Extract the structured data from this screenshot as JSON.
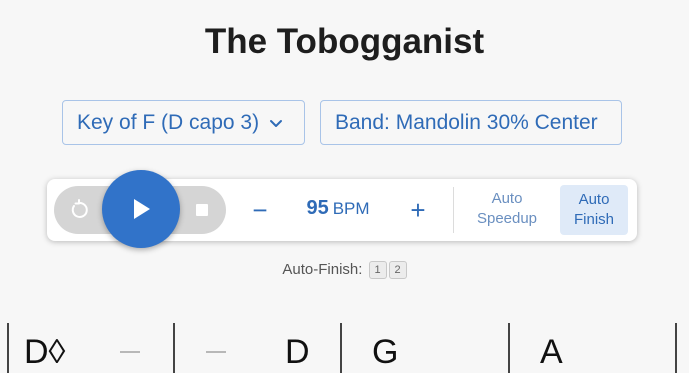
{
  "title": "The Tobogganist",
  "key_selector": {
    "label": "Key of F (D capo 3)",
    "icon": "chevron-down-icon"
  },
  "band_selector": {
    "label": "Band: Mandolin 30% Center"
  },
  "player": {
    "bpm_value": "95",
    "bpm_unit": "BPM",
    "minus_label": "−",
    "plus_label": "+",
    "auto_speedup": [
      "Auto",
      "Speedup"
    ],
    "auto_finish": [
      "Auto",
      "Finish"
    ],
    "auto_finish_active": true
  },
  "auto_finish_caption": {
    "label": "Auto-Finish:",
    "options": [
      "1",
      "2"
    ]
  },
  "chords": {
    "measure1": {
      "chord1": "D◊",
      "chord2": "—"
    },
    "measure2": {
      "chord1": "—",
      "chord2": "D"
    },
    "measure3": {
      "chord1": "G"
    },
    "measure4": {
      "chord1": "A"
    }
  },
  "colors": {
    "accent": "#3173c9",
    "accent_text": "#2f6bb7",
    "active_bg": "#dfeaf8",
    "background": "#f7f7f7"
  }
}
